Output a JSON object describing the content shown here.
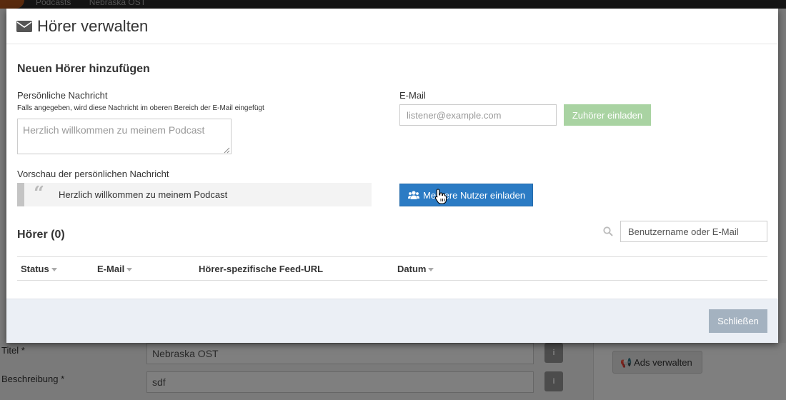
{
  "background": {
    "breadcrumb": [
      "Podcasts",
      "Nebraska OST"
    ],
    "fields": [
      {
        "label": "Titel *",
        "value": "Nebraska OST"
      },
      {
        "label": "Beschreibung *",
        "value": "sdf"
      }
    ],
    "info_glyph": "i",
    "ads_button_label": "Ads verwalten",
    "ads_icon": "megaphone-icon"
  },
  "modal": {
    "title": "Hörer verwalten",
    "title_icon": "envelope-icon",
    "add_section": {
      "title": "Neuen Hörer hinzufügen",
      "personal_message_label": "Persönliche Nachricht",
      "personal_message_hint": "Falls angegeben, wird diese Nachricht im oberen Bereich der E-Mail eingefügt",
      "personal_message_placeholder": "Herzlich willkommen zu meinem Podcast",
      "preview_label": "Vorschau der persönlichen Nachricht",
      "preview_text": "Herzlich willkommen zu meinem Podcast",
      "email_label": "E-Mail",
      "email_placeholder": "listener@example.com",
      "invite_button": "Zuhörer einladen",
      "invite_multiple_button": "Mehrere Nutzer einladen"
    },
    "listeners": {
      "title": "Hörer (0)",
      "search_placeholder": "Benutzername oder E-Mail",
      "columns": [
        {
          "label": "Status",
          "sortable": true
        },
        {
          "label": "E-Mail",
          "sortable": true
        },
        {
          "label": "Hörer-spezifische Feed-URL",
          "sortable": false
        },
        {
          "label": "Datum",
          "sortable": true
        }
      ],
      "rows": []
    },
    "close_button": "Schließen"
  },
  "colors": {
    "primary": "#2b7bc4",
    "success_disabled": "#a9d3a2",
    "footer_bg": "#ebeff5",
    "close_button": "#a4b2c0"
  }
}
